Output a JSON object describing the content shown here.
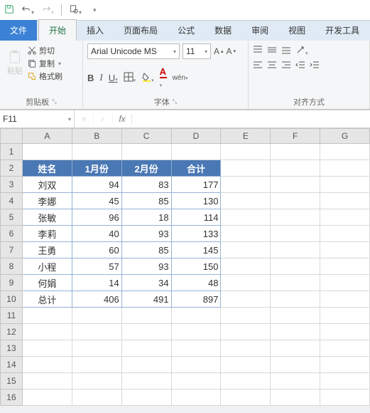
{
  "qat": {
    "save": "save",
    "undo": "undo",
    "redo": "redo",
    "print": "print"
  },
  "tabs": {
    "file": "文件",
    "home": "开始",
    "insert": "插入",
    "layout": "页面布局",
    "formula": "公式",
    "data": "数据",
    "review": "审阅",
    "view": "视图",
    "dev": "开发工具"
  },
  "ribbon": {
    "paste": "粘贴",
    "cut": "剪切",
    "copy": "复制",
    "fmtpaint": "格式刷",
    "clip_lbl": "剪贴板",
    "font_name": "Arial Unicode MS",
    "font_size": "11",
    "font_lbl": "字体",
    "align_lbl": "对齐方式",
    "wen": "wén"
  },
  "namebox": "F11",
  "fx_label": "fx",
  "cols": [
    "A",
    "B",
    "C",
    "D",
    "E",
    "F",
    "G"
  ],
  "rows": [
    1,
    2,
    3,
    4,
    5,
    6,
    7,
    8,
    9,
    10,
    11,
    12,
    13,
    14,
    15,
    16
  ],
  "headers": [
    "姓名",
    "1月份",
    "2月份",
    "合计"
  ],
  "data": [
    [
      "刘双",
      94,
      83,
      177
    ],
    [
      "李娜",
      45,
      85,
      130
    ],
    [
      "张敏",
      96,
      18,
      114
    ],
    [
      "李莉",
      40,
      93,
      133
    ],
    [
      "王勇",
      60,
      85,
      145
    ],
    [
      "小程",
      57,
      93,
      150
    ],
    [
      "何娟",
      14,
      34,
      48
    ],
    [
      "总计",
      406,
      491,
      897
    ]
  ]
}
